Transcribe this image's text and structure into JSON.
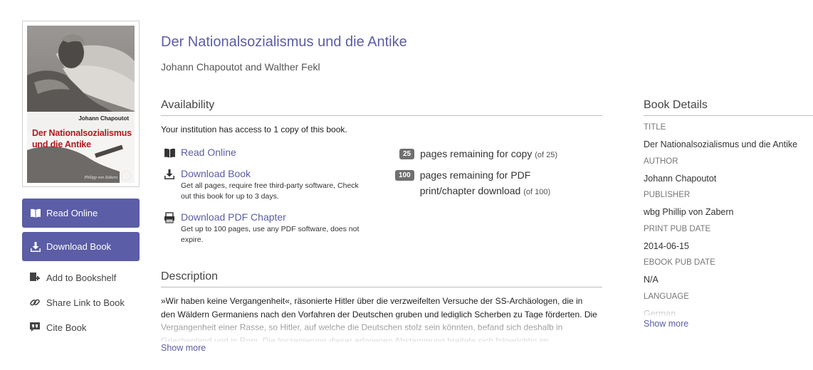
{
  "cover": {
    "author_text": "Johann Chapoutot",
    "title_text": "Der Nationalsozialismus und die Antike",
    "publisher_text": "Philipp von Zabern"
  },
  "sidebar": {
    "read_online": "Read Online",
    "download_book": "Download Book",
    "add_bookshelf": "Add to Bookshelf",
    "share_link": "Share Link to Book",
    "cite_book": "Cite Book"
  },
  "book": {
    "title": "Der Nationalsozialismus und die Antike",
    "authors": "Johann Chapoutot and Walther Fekl"
  },
  "availability": {
    "heading": "Availability",
    "access_text": "Your institution has access to 1 copy of this book.",
    "options": [
      {
        "label": "Read Online",
        "description": ""
      },
      {
        "label": "Download Book",
        "description": "Get all pages, require free third-party software, Check out this book for up to 3 days."
      },
      {
        "label": "Download PDF Chapter",
        "description": "Get up to 100 pages, use any PDF software, does not expire."
      }
    ],
    "quota": [
      {
        "badge": "25",
        "text": "pages remaining for copy",
        "note": "(of 25)"
      },
      {
        "badge": "100",
        "text": "pages remaining for PDF print/chapter download",
        "note": "(of 100)"
      }
    ]
  },
  "description": {
    "heading": "Description",
    "text": "»Wir haben keine Vergangenheit«, räsonierte Hitler über die verzweifelten Versuche der SS-Archäologen, die in den Wäldern Germaniens nach den Vorfahren der Deutschen gruben und lediglich Scherben zu Tage förderten. Die Vergangenheit einer Rasse, so Hitler, auf welche die Deutschen stolz sein könnten, befand sich deshalb in Griechenland und in Rom. Die Inszenierung dieser erlogenen Abstammung breitete sich folgerichtig im",
    "show_more": "Show more"
  },
  "details": {
    "heading": "Book Details",
    "items": [
      {
        "label": "TITLE",
        "value": "Der Nationalsozialismus und die Antike"
      },
      {
        "label": "AUTHOR",
        "value": "Johann Chapoutot"
      },
      {
        "label": "PUBLISHER",
        "value": "wbg Phillip von Zabern"
      },
      {
        "label": "PRINT PUB DATE",
        "value": "2014-06-15"
      },
      {
        "label": "EBOOK PUB DATE",
        "value": "N/A"
      },
      {
        "label": "LANGUAGE",
        "value": "German"
      }
    ],
    "show_more": "Show more"
  },
  "colors": {
    "accent": "#5b5da6",
    "badge": "#707070",
    "cover_title": "#b3181f"
  },
  "icons": {
    "read": "book-open-icon",
    "download": "download-icon",
    "pdf": "pdf-icon",
    "bookshelf": "bookshelf-add-icon",
    "share": "link-icon",
    "cite": "quote-icon"
  }
}
